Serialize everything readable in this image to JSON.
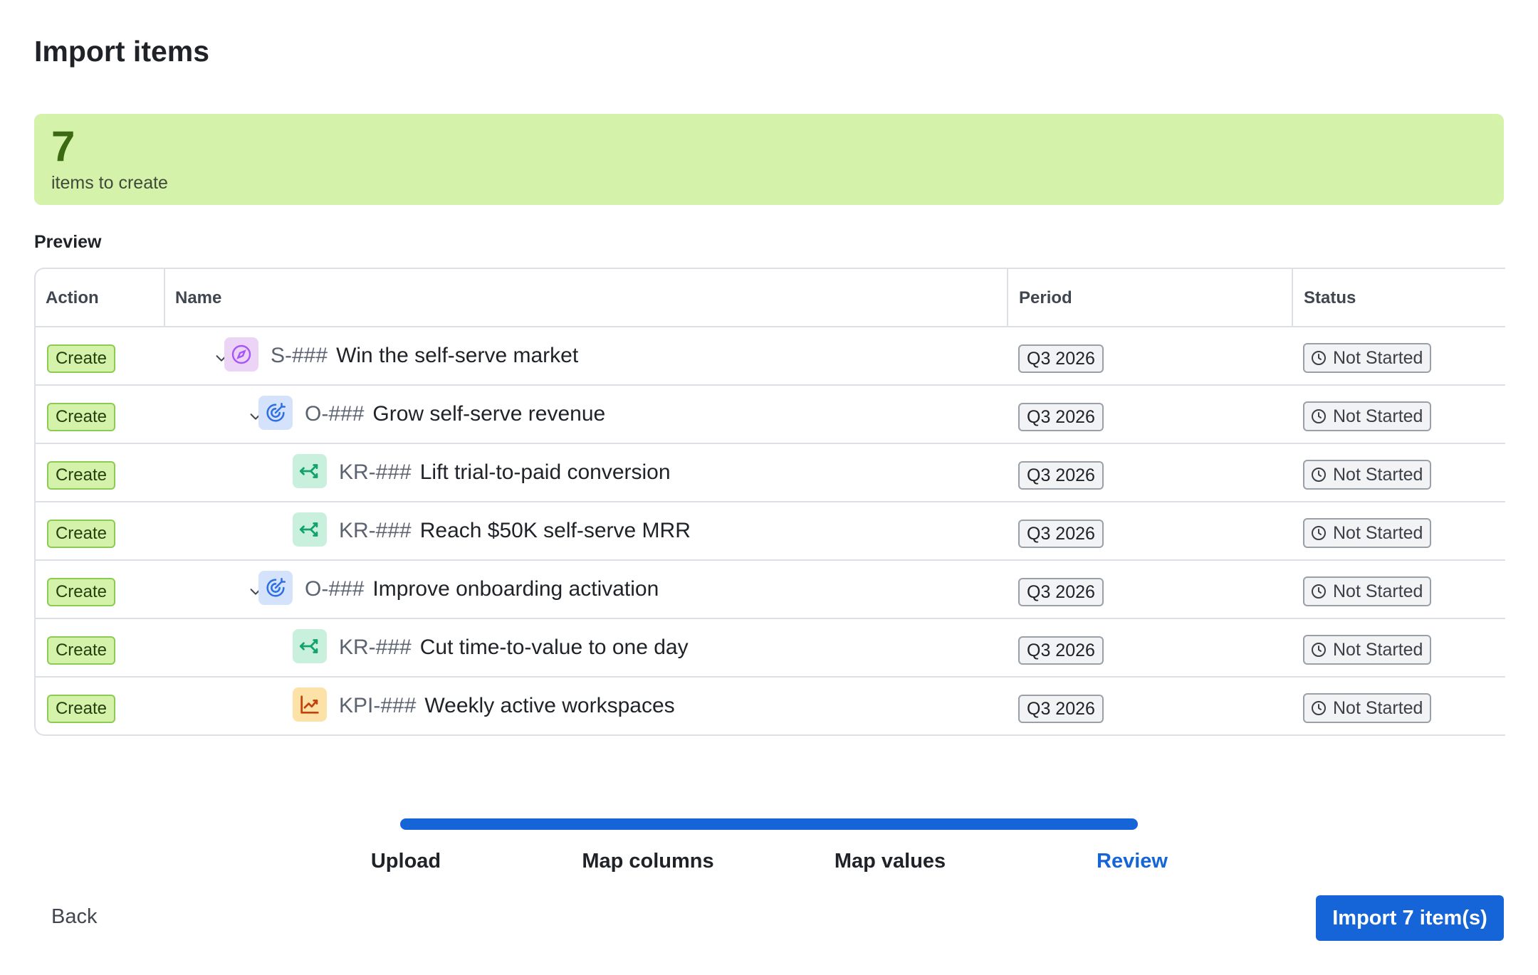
{
  "dialog": {
    "title": "Import items"
  },
  "summary": {
    "count": "7",
    "label": "items to create"
  },
  "preview": {
    "label": "Preview",
    "columns": {
      "action": "Action",
      "name": "Name",
      "period": "Period",
      "status": "Status"
    },
    "rows": [
      {
        "action": "Create",
        "code": "S-###",
        "name": "Win the self-serve market",
        "type_icon": "compass-icon",
        "period": "Q3 2026",
        "status": "Not Started",
        "expandable": true
      },
      {
        "action": "Create",
        "code": "O-###",
        "name": "Grow self-serve revenue",
        "type_icon": "target-icon",
        "period": "Q3 2026",
        "status": "Not Started",
        "expandable": true
      },
      {
        "action": "Create",
        "code": "KR-###",
        "name": "Lift trial-to-paid conversion",
        "type_icon": "key-result-icon",
        "period": "Q3 2026",
        "status": "Not Started",
        "expandable": false
      },
      {
        "action": "Create",
        "code": "KR-###",
        "name": "Reach $50K self-serve MRR",
        "type_icon": "key-result-icon",
        "period": "Q3 2026",
        "status": "Not Started",
        "expandable": false
      },
      {
        "action": "Create",
        "code": "O-###",
        "name": "Improve onboarding activation",
        "type_icon": "target-icon",
        "period": "Q3 2026",
        "status": "Not Started",
        "expandable": true
      },
      {
        "action": "Create",
        "code": "KR-###",
        "name": "Cut time-to-value to one day",
        "type_icon": "key-result-icon",
        "period": "Q3 2026",
        "status": "Not Started",
        "expandable": false
      },
      {
        "action": "Create",
        "code": "KPI-###",
        "name": "Weekly active workspaces",
        "type_icon": "trend-chart-icon",
        "period": "Q3 2026",
        "status": "Not Started",
        "expandable": false
      }
    ]
  },
  "stepper": {
    "progress": 1.0,
    "steps": [
      {
        "label": "Upload",
        "active": false
      },
      {
        "label": "Map columns",
        "active": false
      },
      {
        "label": "Map values",
        "active": false
      },
      {
        "label": "Review",
        "active": true
      }
    ]
  },
  "footer": {
    "back_label": "Back",
    "import_label": "Import 7 item(s)"
  },
  "colors": {
    "primary": "#1565d8",
    "success_bg": "#d5f2ab",
    "success_border": "#8ccb52",
    "strategy_icon": "#a855f7",
    "objective_icon": "#2f6fe0",
    "kr_icon": "#12a26a",
    "kpi_icon": "#d97706"
  }
}
